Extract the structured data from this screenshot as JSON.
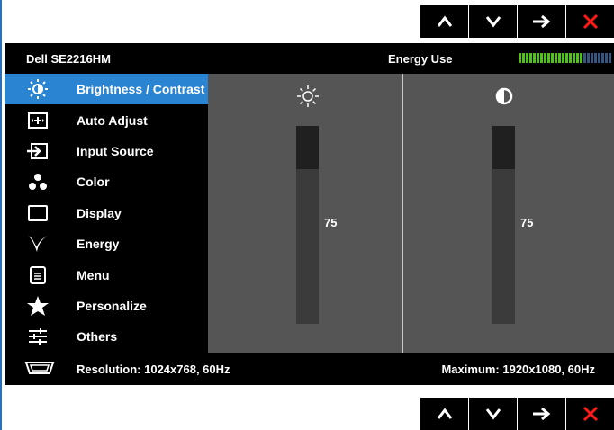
{
  "model": "Dell  SE2216HM",
  "energy": {
    "label": "Energy Use",
    "level_fraction": 0.7,
    "active_color": "#4ec21b",
    "inactive_color": "#35577f"
  },
  "nav_buttons": [
    {
      "icon": "up-icon",
      "color": "#ffffff"
    },
    {
      "icon": "down-icon",
      "color": "#ffffff"
    },
    {
      "icon": "right-arrow-icon",
      "color": "#ffffff"
    },
    {
      "icon": "close-icon",
      "color": "#ff1a1a"
    }
  ],
  "menu": {
    "items": [
      {
        "label": "Brightness / Contrast",
        "icon": "brightness-icon",
        "selected": true
      },
      {
        "label": "Auto Adjust",
        "icon": "auto-adjust-icon"
      },
      {
        "label": "Input Source",
        "icon": "input-source-icon"
      },
      {
        "label": "Color",
        "icon": "color-icon"
      },
      {
        "label": "Display",
        "icon": "display-icon"
      },
      {
        "label": "Energy",
        "icon": "energy-leaf-icon"
      },
      {
        "label": "Menu",
        "icon": "menu-icon"
      },
      {
        "label": "Personalize",
        "icon": "star-icon"
      },
      {
        "label": "Others",
        "icon": "sliders-icon"
      }
    ],
    "selected_color": "#2a84d2"
  },
  "brightness": {
    "icon": "sun-icon",
    "value": 75,
    "value_text": "75"
  },
  "contrast": {
    "icon": "contrast-icon",
    "value": 75,
    "value_text": "75"
  },
  "footer": {
    "icon": "vga-connector-icon",
    "resolution": "Resolution: 1024x768,  60Hz",
    "maximum": "Maximum: 1920x1080,  60Hz"
  }
}
